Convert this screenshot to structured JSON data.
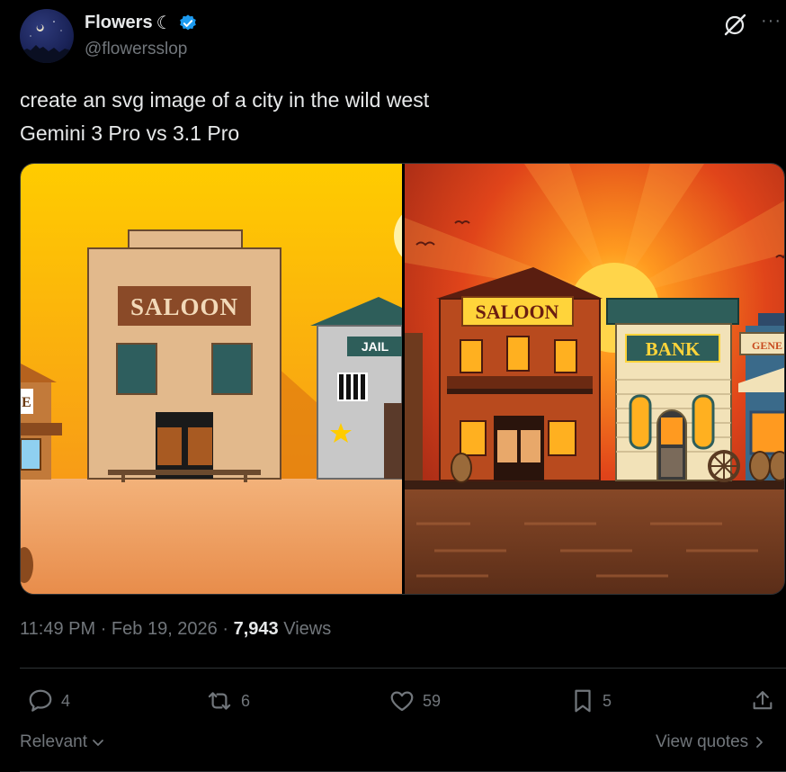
{
  "author": {
    "name": "Flowers",
    "moon_glyph": "☾",
    "handle": "@flowersslop",
    "verified": true
  },
  "tweet": {
    "line1": "create an svg image of a city in the wild west",
    "line2": "Gemini 3 Pro vs 3.1 Pro"
  },
  "media": {
    "left": {
      "saloon_sign": "SALOON",
      "jail_sign": "JAIL",
      "partial_sign": "E"
    },
    "right": {
      "saloon_sign": "SALOON",
      "bank_sign": "BANK",
      "general_sign": "GENE"
    }
  },
  "meta": {
    "time": "11:49 PM",
    "sep1": "·",
    "date": "Feb 19, 2026",
    "sep2": "·",
    "views_count": "7,943",
    "views_label": "Views"
  },
  "actions": {
    "replies": "4",
    "reposts": "6",
    "likes": "59",
    "bookmarks": "5"
  },
  "footer": {
    "sort_label": "Relevant",
    "view_quotes": "View quotes"
  },
  "colors": {
    "verified": "#1d9bf0",
    "muted": "#71767b",
    "text": "#e7e9ea",
    "divider": "#2f3336"
  }
}
